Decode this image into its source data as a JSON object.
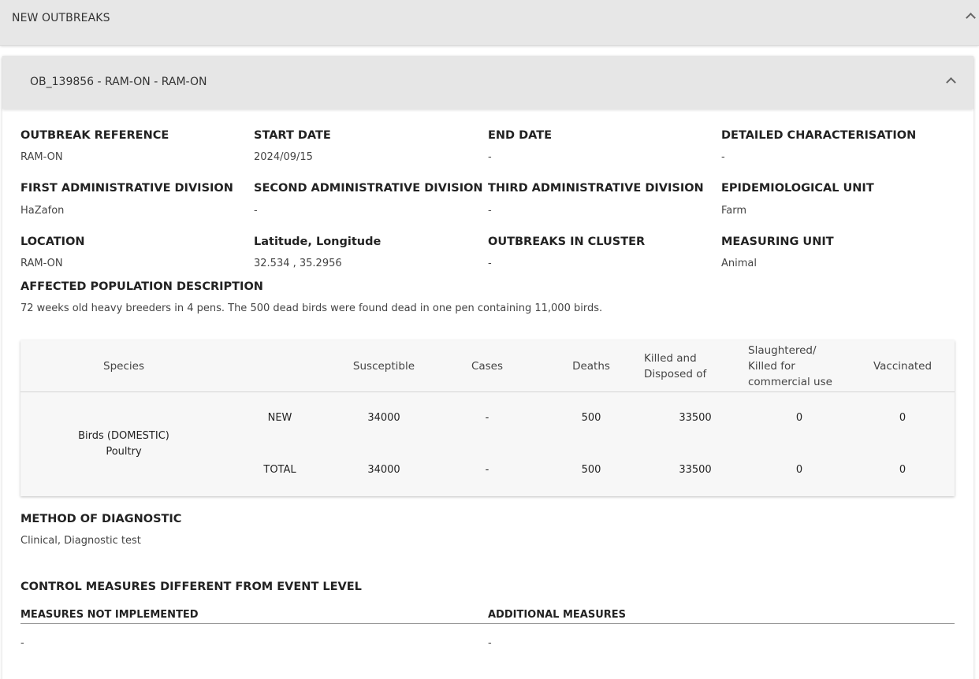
{
  "section": {
    "title": "NEW OUTBREAKS"
  },
  "outbreak": {
    "title": "OB_139856 - RAM-ON - RAM-ON",
    "fields": {
      "outbreak_reference": {
        "label": "OUTBREAK REFERENCE",
        "value": "RAM-ON"
      },
      "start_date": {
        "label": "START DATE",
        "value": "2024/09/15"
      },
      "end_date": {
        "label": "END DATE",
        "value": "-"
      },
      "detailed_characterisation": {
        "label": "DETAILED CHARACTERISATION",
        "value": "-"
      },
      "first_admin_division": {
        "label": "FIRST ADMINISTRATIVE DIVISION",
        "value": "HaZafon"
      },
      "second_admin_division": {
        "label": "SECOND ADMINISTRATIVE DIVISION",
        "value": "-"
      },
      "third_admin_division": {
        "label": "THIRD ADMINISTRATIVE DIVISION",
        "value": "-"
      },
      "epidemiological_unit": {
        "label": "EPIDEMIOLOGICAL UNIT",
        "value": "Farm"
      },
      "location": {
        "label": "LOCATION",
        "value": "RAM-ON"
      },
      "lat_long": {
        "label": "Latitude, Longitude",
        "value": "32.534 , 35.2956"
      },
      "outbreaks_in_cluster": {
        "label": "OUTBREAKS IN CLUSTER",
        "value": "-"
      },
      "measuring_unit": {
        "label": "MEASURING UNIT",
        "value": "Animal"
      },
      "affected_population": {
        "label": "AFFECTED POPULATION DESCRIPTION",
        "value": "72 weeks old heavy breeders in 4 pens. The 500 dead birds were found dead in one pen containing 11,000 birds."
      }
    },
    "table": {
      "headers": {
        "species": "Species",
        "susceptible": "Susceptible",
        "cases": "Cases",
        "deaths": "Deaths",
        "killed_line1": "Killed and",
        "killed_line2": "Disposed of",
        "slaughtered_line1": "Slaughtered/",
        "slaughtered_line2": "Killed for",
        "slaughtered_line3": "commercial use",
        "vaccinated": "Vaccinated"
      },
      "species_line1": "Birds (DOMESTIC)",
      "species_line2": "Poultry",
      "rows": [
        {
          "type": "NEW",
          "susceptible": "34000",
          "cases": "-",
          "deaths": "500",
          "killed": "33500",
          "slaughtered": "0",
          "vaccinated": "0"
        },
        {
          "type": "TOTAL",
          "susceptible": "34000",
          "cases": "-",
          "deaths": "500",
          "killed": "33500",
          "slaughtered": "0",
          "vaccinated": "0"
        }
      ]
    },
    "method_of_diagnostic": {
      "label": "METHOD OF DIAGNOSTIC",
      "value": "Clinical, Diagnostic test"
    },
    "control_measures": {
      "title": "CONTROL MEASURES DIFFERENT FROM EVENT LEVEL",
      "not_implemented_label": "MEASURES NOT IMPLEMENTED",
      "not_implemented_value": "-",
      "additional_label": "ADDITIONAL MEASURES",
      "additional_value": "-"
    }
  }
}
